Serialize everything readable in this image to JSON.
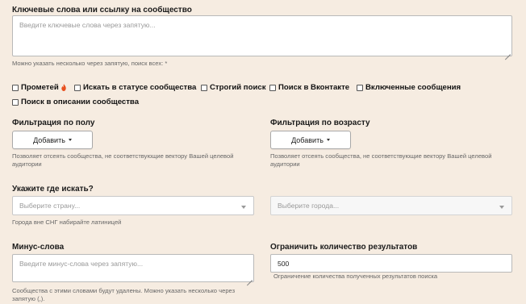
{
  "keywords": {
    "label": "Ключевые слова или ссылку на сообщество",
    "placeholder": "Введите ключевые слова через запятую...",
    "help": "Можно указать несколько через запятую, поиск всех: *"
  },
  "checkboxes": [
    {
      "label": "Прометей"
    },
    {
      "label": "Искать в статусе сообщества"
    },
    {
      "label": "Строгий поиск"
    },
    {
      "label": "Поиск в Вконтакте"
    },
    {
      "label": "Включенные сообщения"
    },
    {
      "label": "Поиск в описании сообщества"
    }
  ],
  "gender_filter": {
    "label": "Фильтрация по полу",
    "button": "Добавить",
    "help": "Позволяет отсеять сообщества, не соответствующие вектору Вашей целевой аудитории"
  },
  "age_filter": {
    "label": "Фильтрация по возрасту",
    "button": "Добавить",
    "help": "Позволяет отсеять сообщества, не соответствующие вектору Вашей целевой аудитории"
  },
  "location": {
    "label": "Укажите где искать?",
    "country_placeholder": "Выберите страну...",
    "city_placeholder": "Выберите города...",
    "help": "Города вне СНГ набирайте латиницей"
  },
  "minus_words": {
    "label": "Минус-слова",
    "placeholder": "Введите минус-слова через запятую...",
    "help": "Сообщества с этими словами будут удалены. Можно указать несколько через запятую (,)."
  },
  "limit": {
    "label": "Ограничить количество результатов",
    "value": "500",
    "help": "Ограничение количества полученных результатов поиска"
  },
  "colors": {
    "background": "#f6ece1",
    "fire_icon": "#e8501f"
  }
}
